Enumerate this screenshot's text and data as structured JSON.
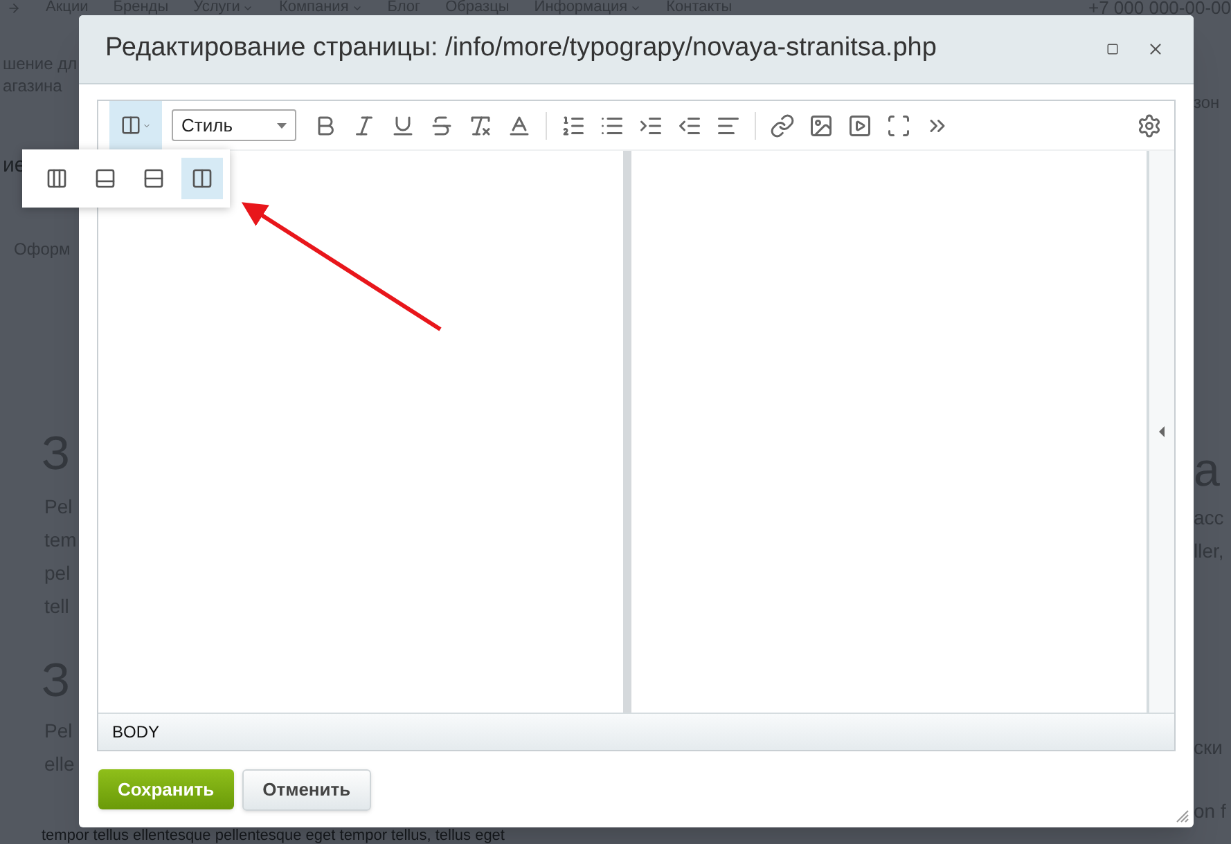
{
  "background_page": {
    "nav": [
      {
        "label": "Акции",
        "has_menu": false
      },
      {
        "label": "Бренды",
        "has_menu": false
      },
      {
        "label": "Услуги",
        "has_menu": true
      },
      {
        "label": "Компания",
        "has_menu": true
      },
      {
        "label": "Блог",
        "has_menu": false
      },
      {
        "label": "Образцы",
        "has_menu": false
      },
      {
        "label": "Информация",
        "has_menu": true
      },
      {
        "label": "Контакты",
        "has_menu": false
      }
    ],
    "phone": "+7 000 000-00-00",
    "left_fragments": [
      {
        "text": "шение дл",
        "kind": "small"
      },
      {
        "text": "агазина",
        "kind": "small"
      },
      {
        "text": "ие",
        "kind": "dark"
      },
      {
        "text": "Оформ",
        "kind": "small"
      },
      {
        "text": "З",
        "kind": "heading"
      },
      {
        "text": "Pel",
        "kind": "body"
      },
      {
        "text": "tem",
        "kind": "body"
      },
      {
        "text": "pel",
        "kind": "body"
      },
      {
        "text": "tell",
        "kind": "body"
      },
      {
        "text": "З",
        "kind": "heading"
      },
      {
        "text": "Pel",
        "kind": "body"
      },
      {
        "text": "elle",
        "kind": "body"
      }
    ],
    "right_fragments": [
      {
        "text": "зон",
        "kind": "small"
      },
      {
        "text": "а",
        "kind": "heading"
      },
      {
        "text": "асс",
        "kind": "body"
      },
      {
        "text": "ller,",
        "kind": "body"
      },
      {
        "text": "ски",
        "kind": "body"
      },
      {
        "text": "on f",
        "kind": "body"
      }
    ],
    "bottom_line": "tempor tellus ellentesque pellentesque eget tempor tellus, tellus eget"
  },
  "dialog": {
    "title": "Редактирование страницы: /info/more/typograpy/novaya-stranitsa.php",
    "style_select": {
      "value": "Стиль"
    },
    "view_modes": [
      {
        "selected": false
      },
      {
        "selected": false
      },
      {
        "selected": false
      },
      {
        "selected": true
      }
    ],
    "path_bar": "BODY",
    "buttons": [
      {
        "label": "Сохранить",
        "kind": "primary"
      },
      {
        "label": "Отменить",
        "kind": "secondary"
      }
    ]
  }
}
